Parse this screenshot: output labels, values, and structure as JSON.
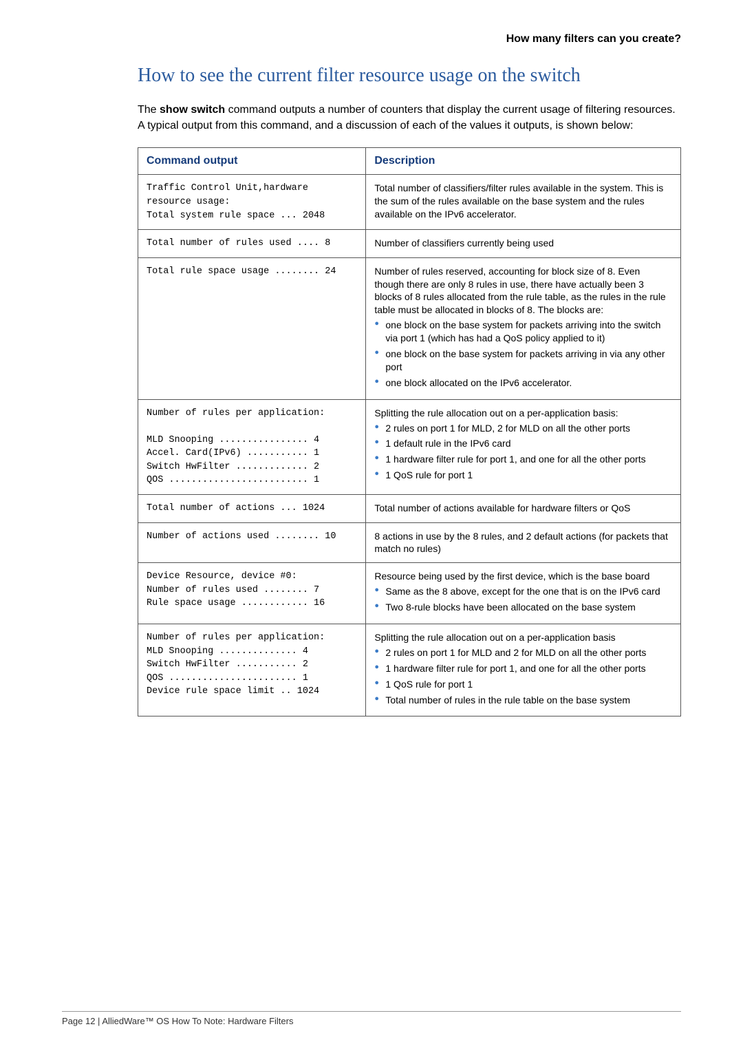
{
  "header_right": "How many filters can you create?",
  "title": "How to see the current filter resource usage on the switch",
  "intro_parts": {
    "p1": "The ",
    "cmd": "show switch",
    "p2": " command outputs a number of counters that display the current usage of filtering resources. A typical output from this command, and a discussion of each of the values it outputs, is shown below:"
  },
  "table": {
    "head_cmd": "Command output",
    "head_desc": "Description",
    "rows": [
      {
        "cmd": "Traffic Control Unit,hardware\nresource usage:\nTotal system rule space ... 2048",
        "desc_text": "Total number of classifiers/filter rules available in the system. This is the sum of the rules available on the base system and the rules available on the IPv6 accelerator."
      },
      {
        "cmd": "Total number of rules used .... 8",
        "desc_text": "Number of classifiers currently being used"
      },
      {
        "cmd": "Total rule space usage ........ 24",
        "desc_text": "Number of rules reserved, accounting for block size of 8. Even though there are only 8 rules in use, there have actually been 3 blocks of 8 rules allocated from the rule table, as the rules in the rule table must be allocated in blocks of 8. The blocks are:",
        "bullets": [
          "one block on the base system for packets arriving into the switch via port 1 (which has had a QoS policy applied to it)",
          "one block on the base system for packets arriving in via any other port",
          "one block allocated on the IPv6 accelerator."
        ]
      },
      {
        "cmd": "Number of rules per application:\n\nMLD Snooping ................ 4\nAccel. Card(IPv6) ........... 1\nSwitch HwFilter ............. 2\nQOS ......................... 1",
        "desc_text": "Splitting the rule allocation out on a per-application basis:",
        "bullets": [
          "2 rules on port 1 for MLD, 2 for MLD on all the other ports",
          "1 default rule in the IPv6 card",
          "1 hardware filter rule for port 1, and one for all the other ports",
          "1 QoS rule for port 1"
        ]
      },
      {
        "cmd": "Total number of actions ... 1024",
        "desc_text": "Total number of actions available for hardware filters or QoS"
      },
      {
        "cmd": "Number of actions used ........ 10",
        "desc_text": "8 actions in use by the 8 rules, and 2 default actions (for packets that match no rules)"
      },
      {
        "cmd": "Device Resource, device #0:\nNumber of rules used ........ 7\nRule space usage ............ 16",
        "desc_text": "Resource being used by the first device, which is the base board",
        "bullets": [
          "Same as the 8 above, except for the one that is on the IPv6 card",
          "Two 8-rule blocks have been allocated on the base system"
        ]
      },
      {
        "cmd": "Number of rules per application:\nMLD Snooping .............. 4\nSwitch HwFilter ........... 2\nQOS ....................... 1\nDevice rule space limit .. 1024",
        "desc_text": "Splitting the rule allocation out on a per-application basis",
        "bullets": [
          "2 rules on port 1 for MLD and 2 for MLD on all the other ports",
          "1 hardware filter rule for port 1, and one for all the other ports",
          "1 QoS rule for port 1",
          "Total number of rules in the rule table on the base system"
        ]
      }
    ]
  },
  "footer": "Page 12 | AlliedWare™ OS How To Note: Hardware Filters"
}
